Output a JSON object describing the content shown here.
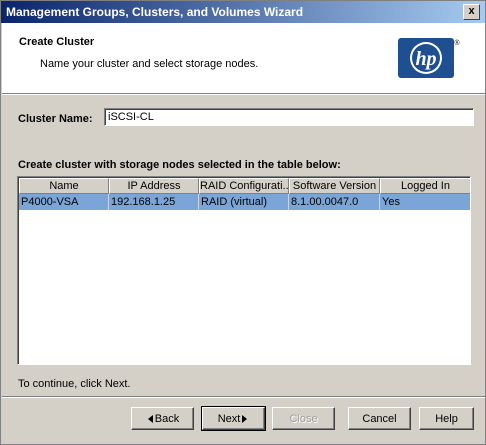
{
  "window": {
    "title": "Management Groups, Clusters, and Volumes Wizard",
    "close_glyph": "x"
  },
  "header": {
    "title": "Create Cluster",
    "subtitle": "Name your cluster and select storage nodes.",
    "logo_text": "hp",
    "logo_mark": "®"
  },
  "form": {
    "cluster_name_label": "Cluster Name:",
    "cluster_name_value": "iSCSI-CL"
  },
  "table": {
    "caption": "Create cluster with storage nodes selected in the table below:",
    "columns": [
      "Name",
      "IP Address",
      "RAID Configurati...",
      "Software Version",
      "Logged In"
    ],
    "rows": [
      [
        "P4000-VSA",
        "192.168.1.25",
        "RAID (virtual)",
        "8.1.00.0047.0",
        "Yes"
      ]
    ]
  },
  "footer": {
    "hint": "To continue, click Next.",
    "back_label": "Back",
    "next_label": "Next",
    "close_label": "Close",
    "cancel_label": "Cancel",
    "help_label": "Help"
  },
  "colors": {
    "selected_row": "#7aa5d6",
    "hp_blue": "#1d4f91"
  }
}
